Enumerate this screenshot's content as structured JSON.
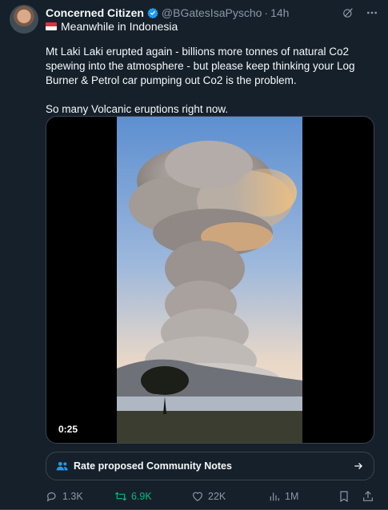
{
  "author": {
    "name": "Concerned Citizen",
    "handle": "@BGatesIsaPyscho",
    "separator": "·",
    "time": "14h",
    "verified_color": "#1d9bf0"
  },
  "subline": "Meanwhile in Indonesia",
  "tweet_text": {
    "paragraph1": "Mt Laki Laki erupted again - billions more tonnes of natural Co2 spewing into the atmosphere - but please keep thinking your Log Burner & Petrol car pumping out Co2 is the problem.",
    "paragraph2": "So many Volcanic eruptions right now."
  },
  "video": {
    "duration": "0:25"
  },
  "community_notes": {
    "label": "Rate proposed Community Notes",
    "icon": "people-icon",
    "color": "#1d9bf0"
  },
  "actions": {
    "replies": "1.3K",
    "reposts": "6.9K",
    "likes": "22K",
    "views": "1M",
    "repost_color": "#00ba7c"
  },
  "colors": {
    "background": "#15202b",
    "text": "#f7f9f9",
    "muted": "#8b98a5",
    "border": "#38444d"
  }
}
